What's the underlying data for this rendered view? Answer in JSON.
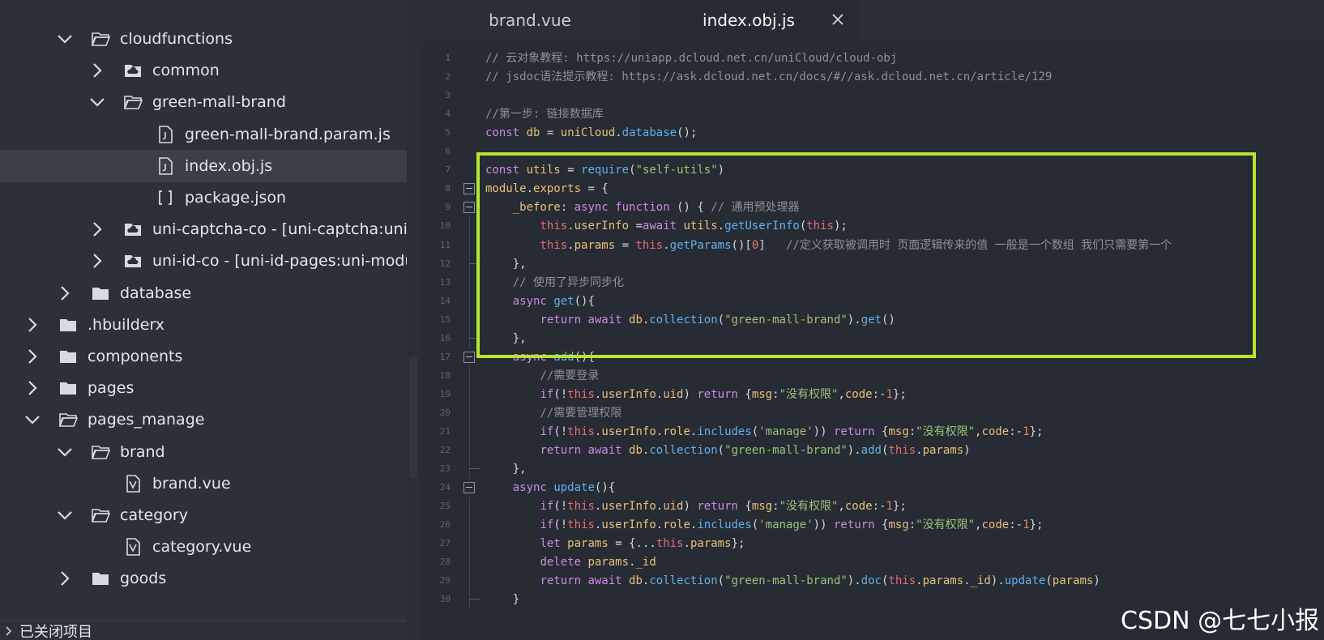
{
  "sidebar": {
    "items": [
      {
        "label": "cloudfunctions",
        "expanded": true,
        "icon": "folder-open-icon"
      },
      {
        "label": "common",
        "expanded": false,
        "icon": "cloud-folder-icon"
      },
      {
        "label": "green-mall-brand",
        "expanded": true,
        "icon": "folder-open-icon"
      },
      {
        "label": "green-mall-brand.param.js",
        "icon": "js-file-icon"
      },
      {
        "label": "index.obj.js",
        "icon": "js-file-icon",
        "selected": true
      },
      {
        "label": "package.json",
        "icon": "json-file-icon"
      },
      {
        "label": "uni-captcha-co - [uni-captcha:uni-mc",
        "expanded": false,
        "icon": "cloud-folder-icon"
      },
      {
        "label": "uni-id-co - [uni-id-pages:uni-module",
        "expanded": false,
        "icon": "cloud-folder-icon"
      },
      {
        "label": "database",
        "expanded": false,
        "icon": "folder-icon"
      },
      {
        "label": ".hbuilderx",
        "expanded": false,
        "icon": "folder-icon"
      },
      {
        "label": "components",
        "expanded": false,
        "icon": "folder-icon"
      },
      {
        "label": "pages",
        "expanded": false,
        "icon": "folder-icon"
      },
      {
        "label": "pages_manage",
        "expanded": true,
        "icon": "folder-open-icon"
      },
      {
        "label": "brand",
        "expanded": true,
        "icon": "folder-open-icon"
      },
      {
        "label": "brand.vue",
        "icon": "vue-file-icon"
      },
      {
        "label": "category",
        "expanded": true,
        "icon": "folder-open-icon"
      },
      {
        "label": "category.vue",
        "icon": "vue-file-icon"
      },
      {
        "label": "goods",
        "expanded": false,
        "icon": "folder-icon"
      }
    ],
    "closed_projects_label": "已关闭项目"
  },
  "tabs": [
    {
      "label": "brand.vue",
      "active": false
    },
    {
      "label": "index.obj.js",
      "active": true
    }
  ],
  "code_lines": [
    "// 云对象教程: https://uniapp.dcloud.net.cn/uniCloud/cloud-obj",
    "// jsdoc语法提示教程: https://ask.dcloud.net.cn/docs/#//ask.dcloud.net.cn/article/129",
    "",
    "//第一步: 链接数据库",
    "const db = uniCloud.database();",
    "",
    "const utils = require(\"self-utils\")",
    "module.exports = {",
    "    _before: async function () { // 通用预处理器",
    "        this.userInfo =await utils.getUserInfo(this);",
    "        this.params = this.getParams()[0]   //定义获取被调用时 页面逻辑传来的值 一般是一个数组 我们只需要第一个",
    "    },",
    "    // 使用了异步同步化",
    "    async get(){",
    "        return await db.collection(\"green-mall-brand\").get()",
    "    },",
    "    async add(){",
    "        //需要登录",
    "        if(!this.userInfo.uid) return {msg:\"没有权限\",code:-1};",
    "        //需要管理权限",
    "        if(!this.userInfo.role.includes('manage')) return {msg:\"没有权限\",code:-1};",
    "        return await db.collection(\"green-mall-brand\").add(this.params)",
    "    },",
    "    async update(){",
    "        if(!this.userInfo.uid) return {msg:\"没有权限\",code:-1};",
    "        if(!this.userInfo.role.includes('manage')) return {msg:\"没有权限\",code:-1};",
    "        let params = {...this.params};",
    "        delete params._id",
    "        return await db.collection(\"green-mall-brand\").doc(this.params._id).update(params)",
    "    }"
  ],
  "watermark": "CSDN @七七小报",
  "colors": {
    "highlight_box": "#b6e62e",
    "editor_bg": "#272b33",
    "sidebar_bg": "#2d3038",
    "selected_row": "#3b3f47"
  }
}
